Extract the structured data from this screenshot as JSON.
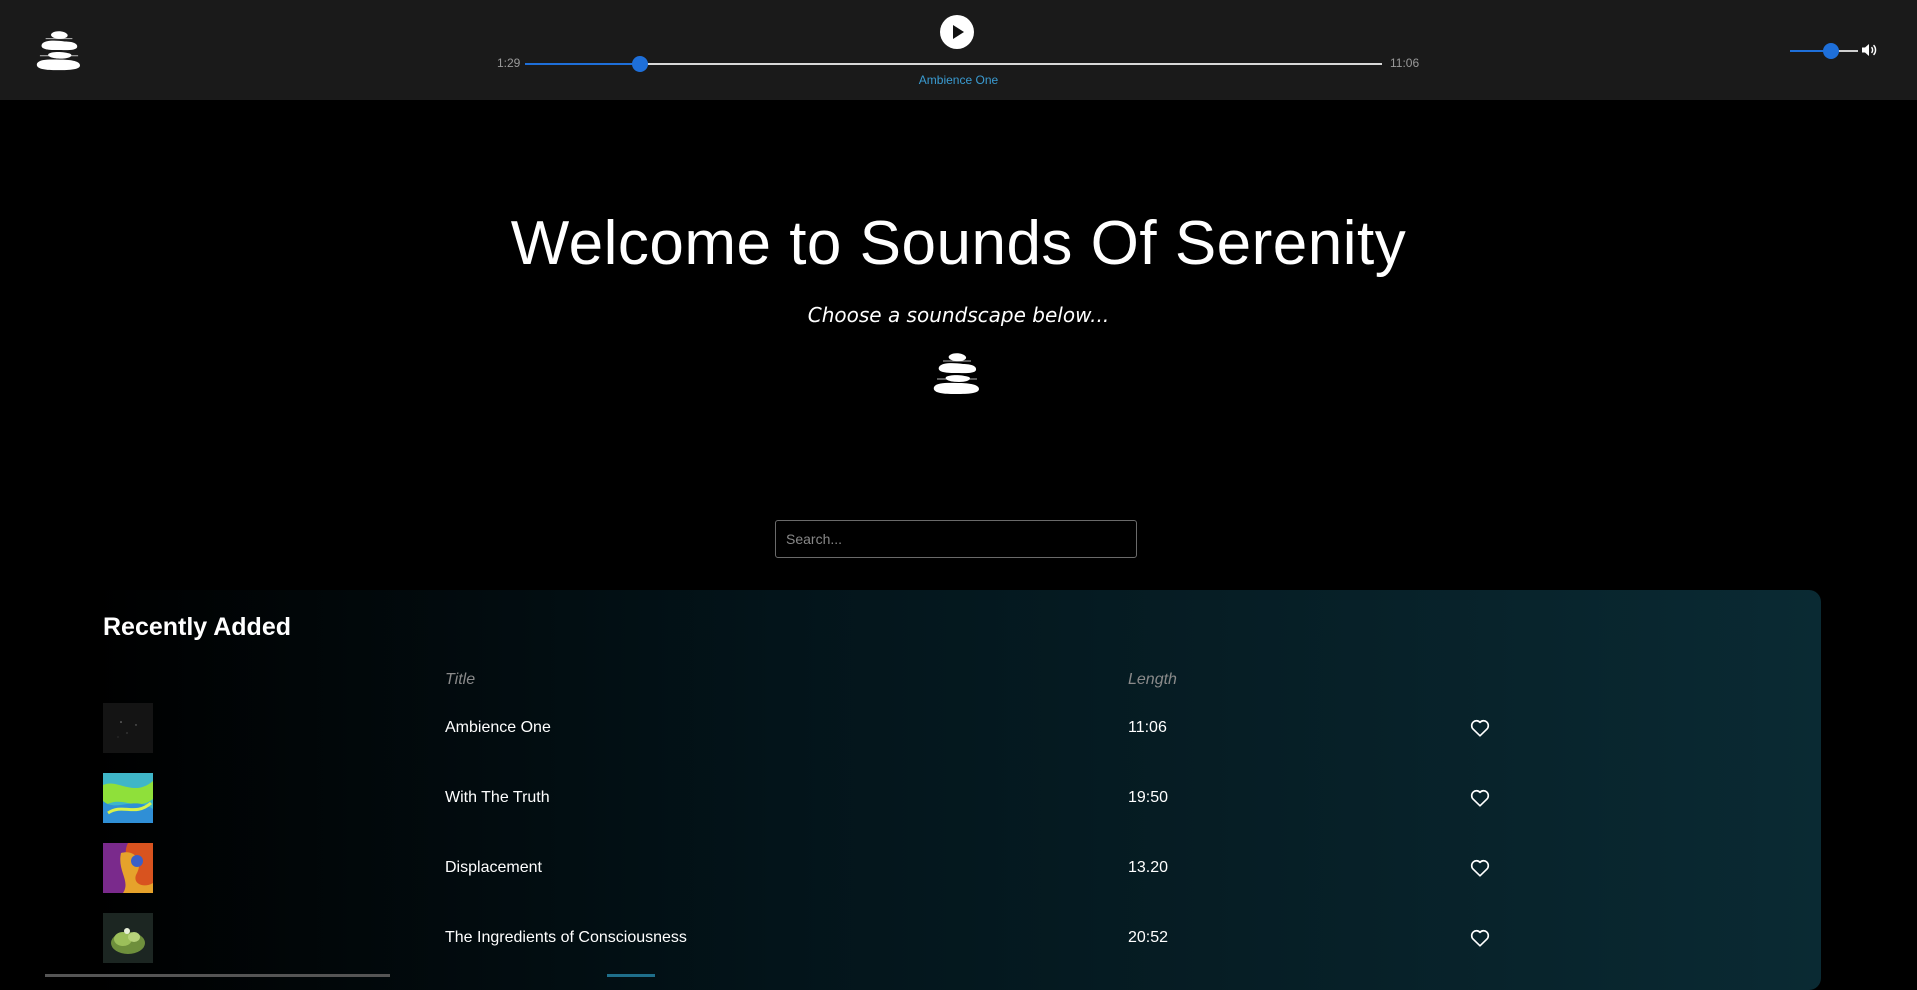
{
  "player": {
    "current_time": "1:29",
    "duration": "11:06",
    "progress_fraction": 0.134,
    "now_playing": "Ambience One",
    "volume_fraction": 0.6,
    "play_icon": "play-icon",
    "volume_icon": "volume-icon"
  },
  "hero": {
    "title": "Welcome to Sounds Of Serenity",
    "subtitle": "Choose a soundscape below..."
  },
  "search": {
    "placeholder": "Search..."
  },
  "recent": {
    "heading": "Recently Added",
    "col_title": "Title",
    "col_length": "Length",
    "tracks": [
      {
        "title": "Ambience One",
        "length": "11:06",
        "thumb": "dark-specks"
      },
      {
        "title": "With The Truth",
        "length": "19:50",
        "thumb": "green-abstract"
      },
      {
        "title": "Displacement",
        "length": "13.20",
        "thumb": "fiery-abstract"
      },
      {
        "title": "The Ingredients of Consciousness",
        "length": "20:52",
        "thumb": "green-plant"
      }
    ]
  },
  "colors": {
    "accent": "#1e6fd9",
    "now_playing": "#3a9bd1",
    "bar": "#1a1a1a"
  }
}
